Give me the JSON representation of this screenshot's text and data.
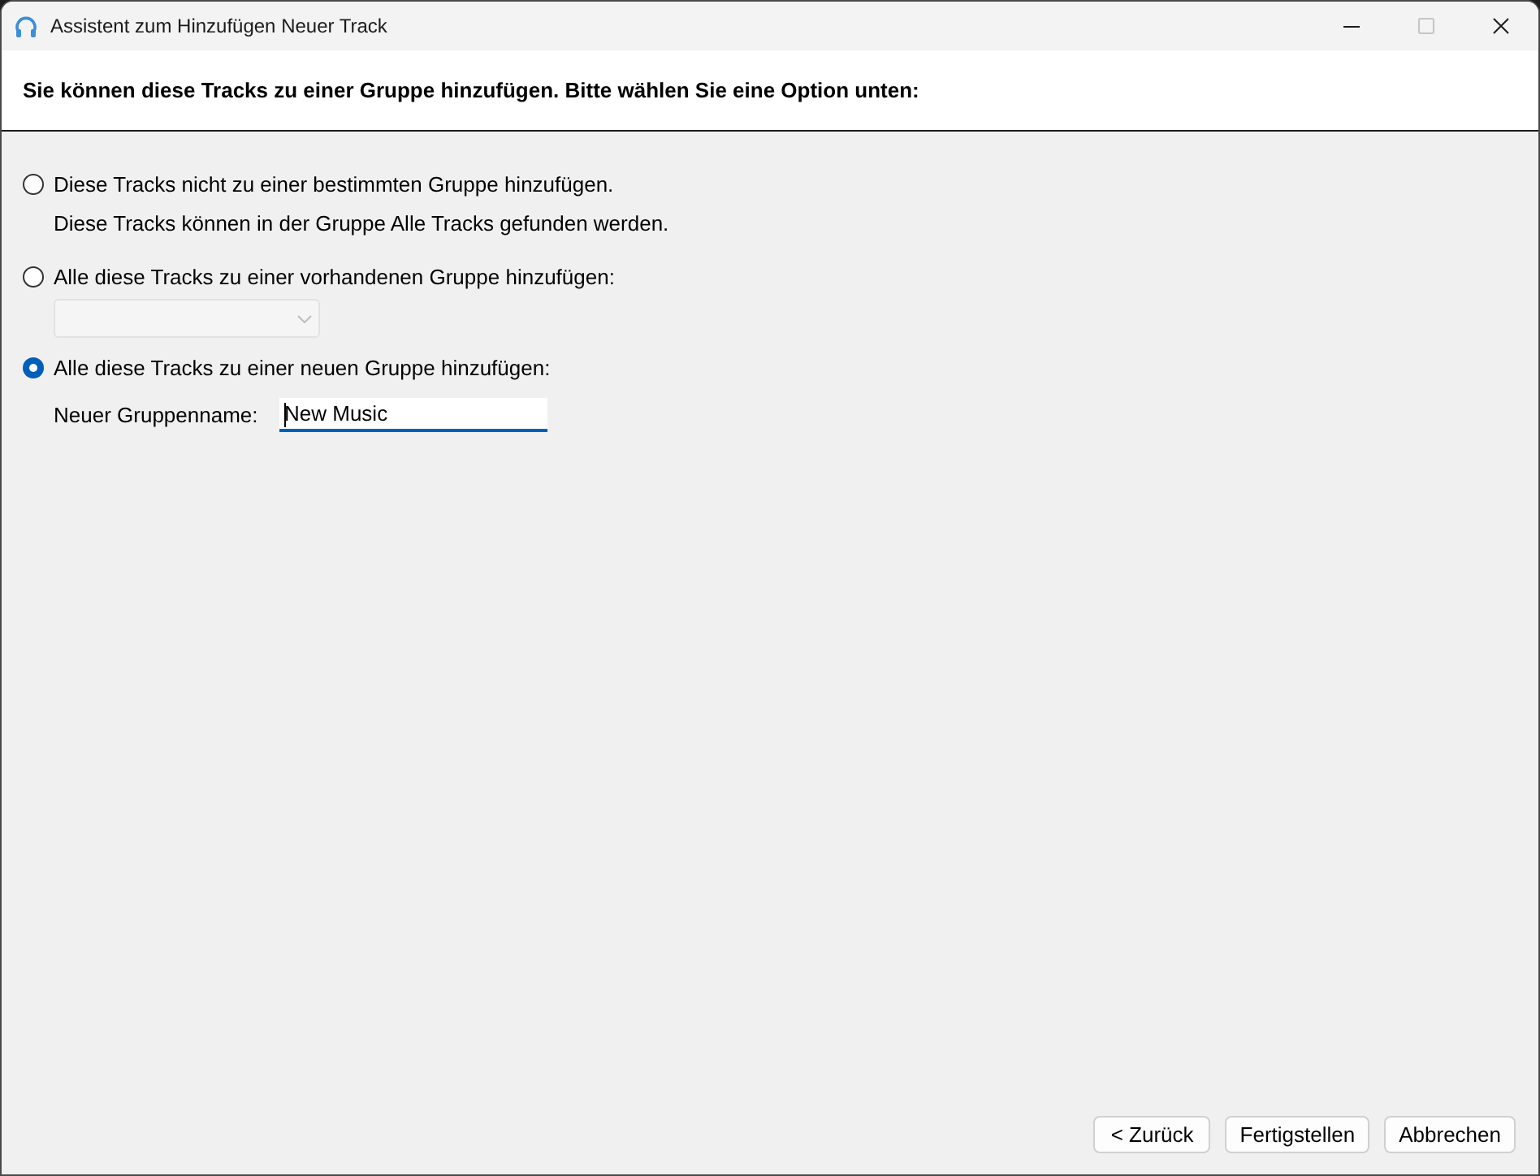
{
  "window": {
    "title": "Assistent zum Hinzufügen Neuer Track",
    "maximize_disabled": true
  },
  "header": {
    "text": "Sie können diese Tracks zu einer Gruppe hinzufügen. Bitte wählen Sie eine Option unten:"
  },
  "options": [
    {
      "kind": "plain",
      "label": "Diese Tracks nicht zu einer bestimmten Gruppe hinzufügen.",
      "selected": false,
      "note": "Diese Tracks können in der Gruppe Alle Tracks gefunden werden."
    },
    {
      "kind": "existing_group",
      "label": "Alle diese Tracks zu einer vorhandenen Gruppe hinzufügen:",
      "selected": false,
      "group_select": {
        "disabled": true
      }
    },
    {
      "kind": "new_group",
      "label": "Alle diese Tracks zu einer neuen Gruppe hinzufügen:",
      "selected": true,
      "name_field": {
        "label": "Neuer Gruppenname:",
        "value": "New Music",
        "focused": true
      }
    }
  ],
  "buttons": [
    {
      "label": "< Zurück"
    },
    {
      "label": "Fertigstellen"
    },
    {
      "label": "Abbrechen"
    }
  ]
}
